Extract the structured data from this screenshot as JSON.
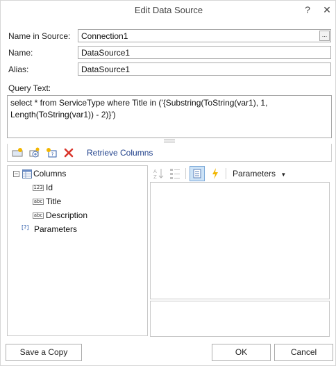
{
  "window": {
    "title": "Edit Data Source",
    "help_label": "?",
    "close_label": "✕"
  },
  "fields": {
    "name_in_source": {
      "label": "Name in Source:",
      "value": "Connection1",
      "browse_label": "..."
    },
    "name": {
      "label": "Name:",
      "value": "DataSource1"
    },
    "alias": {
      "label": "Alias:",
      "value": "DataSource1"
    }
  },
  "query": {
    "label": "Query Text:",
    "value": "select * from ServiceType where Title in ('{Substring(ToString(var1), 1,\nLength(ToString(var1)) - 2)}')"
  },
  "toolbar": {
    "retrieve_columns_label": "Retrieve Columns"
  },
  "tree": {
    "columns_label": "Columns",
    "items": [
      {
        "type_badge": "123",
        "label": "Id"
      },
      {
        "type_badge": "abc",
        "label": "Title"
      },
      {
        "type_badge": "abc",
        "label": "Description"
      }
    ],
    "parameters_label": "Parameters",
    "parameters_badge": "[?]"
  },
  "property_toolbar": {
    "parameters_label": "Parameters"
  },
  "footer": {
    "save_copy_label": "Save a Copy",
    "ok_label": "OK",
    "cancel_label": "Cancel"
  },
  "colors": {
    "accent": "#1e3f8a",
    "selected_bg": "#cde3f7",
    "delete_red": "#d9352b",
    "lightning": "#f2b600"
  }
}
